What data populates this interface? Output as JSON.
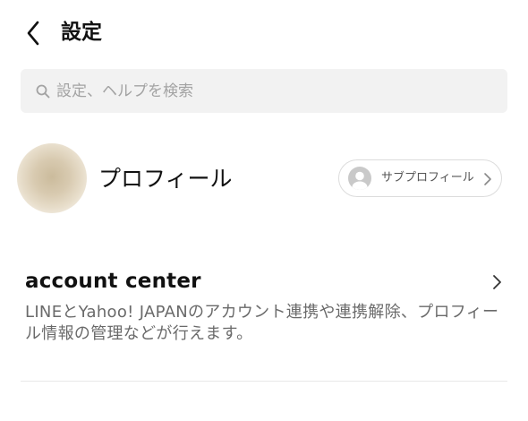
{
  "header": {
    "title": "設定",
    "back_icon": "chevron-left-icon"
  },
  "search": {
    "placeholder": "設定、ヘルプを検索",
    "icon": "search-icon"
  },
  "profile": {
    "name": "プロフィール",
    "sub_profile_label": "サブプロフィール"
  },
  "account_center": {
    "title": "account center",
    "description": "LINEとYahoo! JAPANのアカウント連携や連携解除、プロフィール情報の管理などが行えます。"
  },
  "colors": {
    "background": "#ffffff",
    "search_bg": "#f2f2f2",
    "placeholder_text": "#a3a3a3",
    "secondary_text": "#6a6a6a",
    "divider": "#e8e8e8"
  }
}
